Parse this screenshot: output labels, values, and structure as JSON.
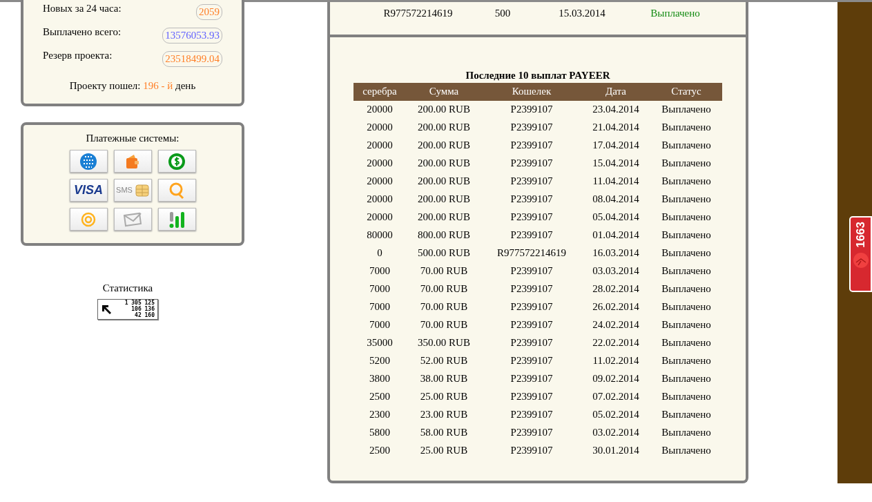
{
  "stats": {
    "rows": [
      {
        "label": "Новых за 24 часа:",
        "value": "2059",
        "color": "#ff7f27"
      },
      {
        "label": "Выплачено всего:",
        "value": "13576053.93",
        "color": "#6060ff"
      },
      {
        "label": "Резерв проекта:",
        "value": "23518499.04",
        "color": "#ff7f27"
      }
    ],
    "days": {
      "prefix": "Проекту пошел:",
      "count": "196 - й",
      "suffix": "день"
    }
  },
  "payment_systems": {
    "title": "Платежные системы:",
    "items": [
      {
        "kind": "webmoney"
      },
      {
        "kind": "wallet"
      },
      {
        "kind": "dollar"
      },
      {
        "kind": "visa",
        "label": "VISA"
      },
      {
        "kind": "sms",
        "label": "SMS"
      },
      {
        "kind": "qiwi"
      },
      {
        "kind": "mail"
      },
      {
        "kind": "envelope"
      },
      {
        "kind": "bars"
      }
    ]
  },
  "statistics": {
    "title": "Статистика",
    "counter": [
      "1 305 125",
      "106 136",
      "42 160"
    ]
  },
  "previous_table": {
    "rows": [
      [
        "R977572214619",
        "500",
        "15.03.2014",
        "Выплачено"
      ]
    ]
  },
  "payouts": {
    "title": "Последние 10 выплат PAYEER",
    "columns": [
      "серебра",
      "Сумма",
      "Кошелек",
      "Дата",
      "Статус"
    ],
    "rows": [
      [
        "20000",
        "200.00 RUB",
        "P2399107",
        "23.04.2014",
        "Выплачено"
      ],
      [
        "20000",
        "200.00 RUB",
        "P2399107",
        "21.04.2014",
        "Выплачено"
      ],
      [
        "20000",
        "200.00 RUB",
        "P2399107",
        "17.04.2014",
        "Выплачено"
      ],
      [
        "20000",
        "200.00 RUB",
        "P2399107",
        "15.04.2014",
        "Выплачено"
      ],
      [
        "20000",
        "200.00 RUB",
        "P2399107",
        "11.04.2014",
        "Выплачено"
      ],
      [
        "20000",
        "200.00 RUB",
        "P2399107",
        "08.04.2014",
        "Выплачено"
      ],
      [
        "20000",
        "200.00 RUB",
        "P2399107",
        "05.04.2014",
        "Выплачено"
      ],
      [
        "80000",
        "800.00 RUB",
        "P2399107",
        "01.04.2014",
        "Выплачено"
      ],
      [
        "0",
        "500.00 RUB",
        "R977572214619",
        "16.03.2014",
        "Выплачено"
      ],
      [
        "7000",
        "70.00 RUB",
        "P2399107",
        "03.03.2014",
        "Выплачено"
      ],
      [
        "7000",
        "70.00 RUB",
        "P2399107",
        "28.02.2014",
        "Выплачено"
      ],
      [
        "7000",
        "70.00 RUB",
        "P2399107",
        "26.02.2014",
        "Выплачено"
      ],
      [
        "7000",
        "70.00 RUB",
        "P2399107",
        "24.02.2014",
        "Выплачено"
      ],
      [
        "35000",
        "350.00 RUB",
        "P2399107",
        "22.02.2014",
        "Выплачено"
      ],
      [
        "5200",
        "52.00 RUB",
        "P2399107",
        "11.02.2014",
        "Выплачено"
      ],
      [
        "3800",
        "38.00 RUB",
        "P2399107",
        "09.02.2014",
        "Выплачено"
      ],
      [
        "2500",
        "25.00 RUB",
        "P2399107",
        "07.02.2014",
        "Выплачено"
      ],
      [
        "2300",
        "23.00 RUB",
        "P2399107",
        "05.02.2014",
        "Выплачено"
      ],
      [
        "5800",
        "58.00 RUB",
        "P2399107",
        "03.02.2014",
        "Выплачено"
      ],
      [
        "2500",
        "25.00 RUB",
        "P2399107",
        "30.01.2014",
        "Выплачено"
      ]
    ]
  },
  "side_badge": {
    "count": "1663"
  }
}
